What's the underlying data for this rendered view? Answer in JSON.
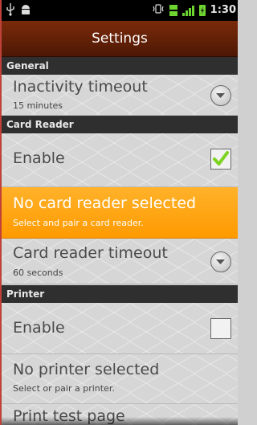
{
  "status_bar": {
    "time": "1:30",
    "icons": [
      "usb-icon",
      "android-debug-icon",
      "vibrate-icon",
      "network-type-icon",
      "signal-icon",
      "battery-charging-icon"
    ]
  },
  "title_bar": {
    "title": "Settings"
  },
  "sections": {
    "general": "General",
    "card_reader": "Card Reader",
    "printer": "Printer"
  },
  "general": {
    "inactivity": {
      "title": "Inactivity timeout",
      "summary": "15 minutes"
    }
  },
  "card_reader": {
    "enable": {
      "title": "Enable",
      "checked": true
    },
    "selection": {
      "title": "No card reader selected",
      "summary": "Select and pair a card reader."
    },
    "timeout": {
      "title": "Card reader timeout",
      "summary": "60 seconds"
    }
  },
  "printer": {
    "enable": {
      "title": "Enable",
      "checked": false
    },
    "selection": {
      "title": "No printer selected",
      "summary": "Select or pair a printer."
    },
    "test": {
      "title": "Print test page"
    }
  },
  "colors": {
    "highlight": "#ff9a00",
    "checkmark": "#7ed322",
    "title_bar": "#5c1e06"
  }
}
